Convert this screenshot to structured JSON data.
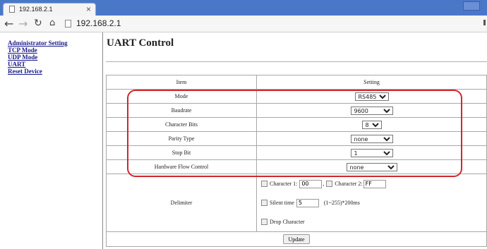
{
  "browser": {
    "tab_title": "192.168.2.1",
    "tab_close": "×",
    "address": "192.168.2.1"
  },
  "sidebar": {
    "items": [
      {
        "label": "Administrator Setting"
      },
      {
        "label": "TCP Mode"
      },
      {
        "label": "UDP Mode"
      },
      {
        "label": "UART"
      },
      {
        "label": "Reset Device"
      }
    ]
  },
  "page": {
    "title": "UART Control"
  },
  "table": {
    "headers": [
      "Item",
      "Setting"
    ],
    "rows": [
      {
        "item": "Mode",
        "value": "RS485"
      },
      {
        "item": "Baudrate",
        "value": "9600"
      },
      {
        "item": "Character Bits",
        "value": "8"
      },
      {
        "item": "Parity Type",
        "value": "none"
      },
      {
        "item": "Stop Bit",
        "value": "1"
      },
      {
        "item": "Hardware Flow Control",
        "value": "none"
      }
    ],
    "delimiter": {
      "label": "Delimiter",
      "char1_label": "Character 1:",
      "char1_value": "00",
      "char2_label": "Character 2:",
      "char2_value": "FF",
      "silent_label": "Silent time",
      "silent_value": "5",
      "silent_unit": "(1~255)*200ms",
      "drop_label": "Drop Character"
    },
    "update_label": "Update"
  },
  "colors": {
    "highlight": "#d2262d",
    "tabbar": "#4a78c8",
    "link": "#1a1a8c"
  }
}
